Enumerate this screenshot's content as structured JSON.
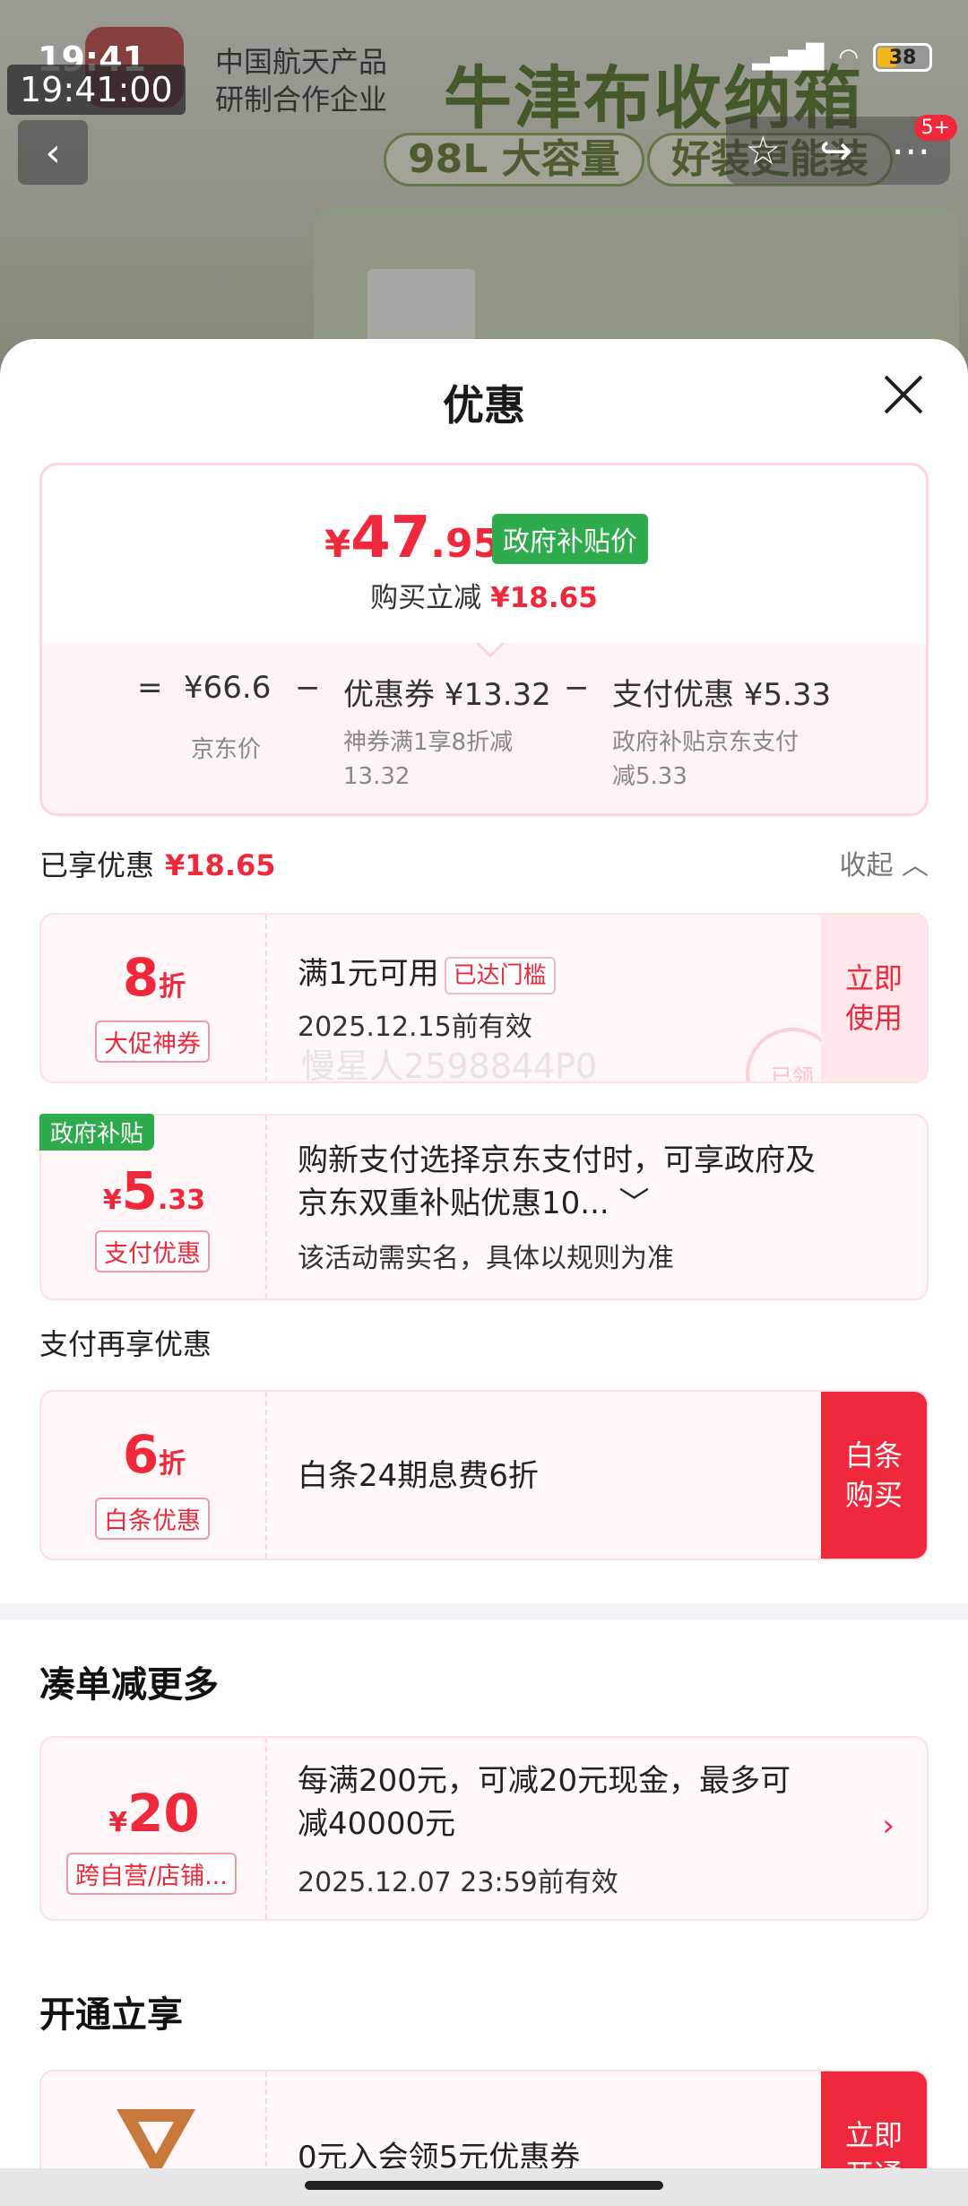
{
  "status_bar": {
    "time": "19:41",
    "battery": "38",
    "time_overlay": "19:41:00"
  },
  "background": {
    "product_title": "牛津布收纳箱",
    "pill1": "98L 大容量",
    "pill2": "好装更能装",
    "coop_line1": "中国航天产品",
    "coop_line2": "研制合作企业",
    "notif_count": "5+"
  },
  "sheet": {
    "title": "优惠",
    "price": {
      "yen": "¥",
      "int": "47",
      "dec": ".95",
      "tag": "政府补贴价"
    },
    "buy_reduce": {
      "label": "购买立减",
      "value": "¥18.65"
    },
    "calc": {
      "eq": "=",
      "base": "¥66.6",
      "base_label": "京东价",
      "minus1": "−",
      "coupon": "优惠券 ¥13.32",
      "coupon_desc1": "神券满1享8折减",
      "coupon_desc2": "13.32",
      "minus2": "−",
      "pay": "支付优惠 ¥5.33",
      "pay_desc1": "政府补贴京东支付",
      "pay_desc2": "减5.33"
    },
    "enjoyed": {
      "label": "已享优惠",
      "value": "¥18.65",
      "collapse": "收起"
    },
    "coupon1": {
      "num": "8",
      "unit": "折",
      "tag": "大促神券",
      "desc": "满1元可用",
      "reached": "已达门槛",
      "valid": "2025.12.15前有效",
      "action": "立即使用",
      "watermark": "慢星人2598844P0",
      "stamp": "已领"
    },
    "coupon2": {
      "corner": "政府补贴",
      "yen": "¥",
      "num": "5",
      "dec": ".33",
      "tag": "支付优惠",
      "desc1": "购新支付选择京东支付时，可享政府及",
      "desc2": "京东双重补贴优惠10...",
      "sub": "该活动需实名，具体以规则为准"
    },
    "pay_more_label": "支付再享优惠",
    "coupon3": {
      "num": "6",
      "unit": "折",
      "tag": "白条优惠",
      "desc": "白条24期息费6折",
      "action": "白条购买"
    },
    "more_section": "凑单减更多",
    "coupon4": {
      "yen": "¥",
      "num": "20",
      "tag": "跨自营/店铺...",
      "desc1": "每满200元，可减20元现金，最多可",
      "desc2": "减40000元",
      "valid": "2025.12.07 23:59前有效"
    },
    "open_section": "开通立享",
    "coupon5": {
      "desc": "0元入会领5元优惠券",
      "action": "立即开通"
    }
  },
  "colors": {
    "accent": "#f0283c",
    "gov_green": "#2dab4d"
  }
}
